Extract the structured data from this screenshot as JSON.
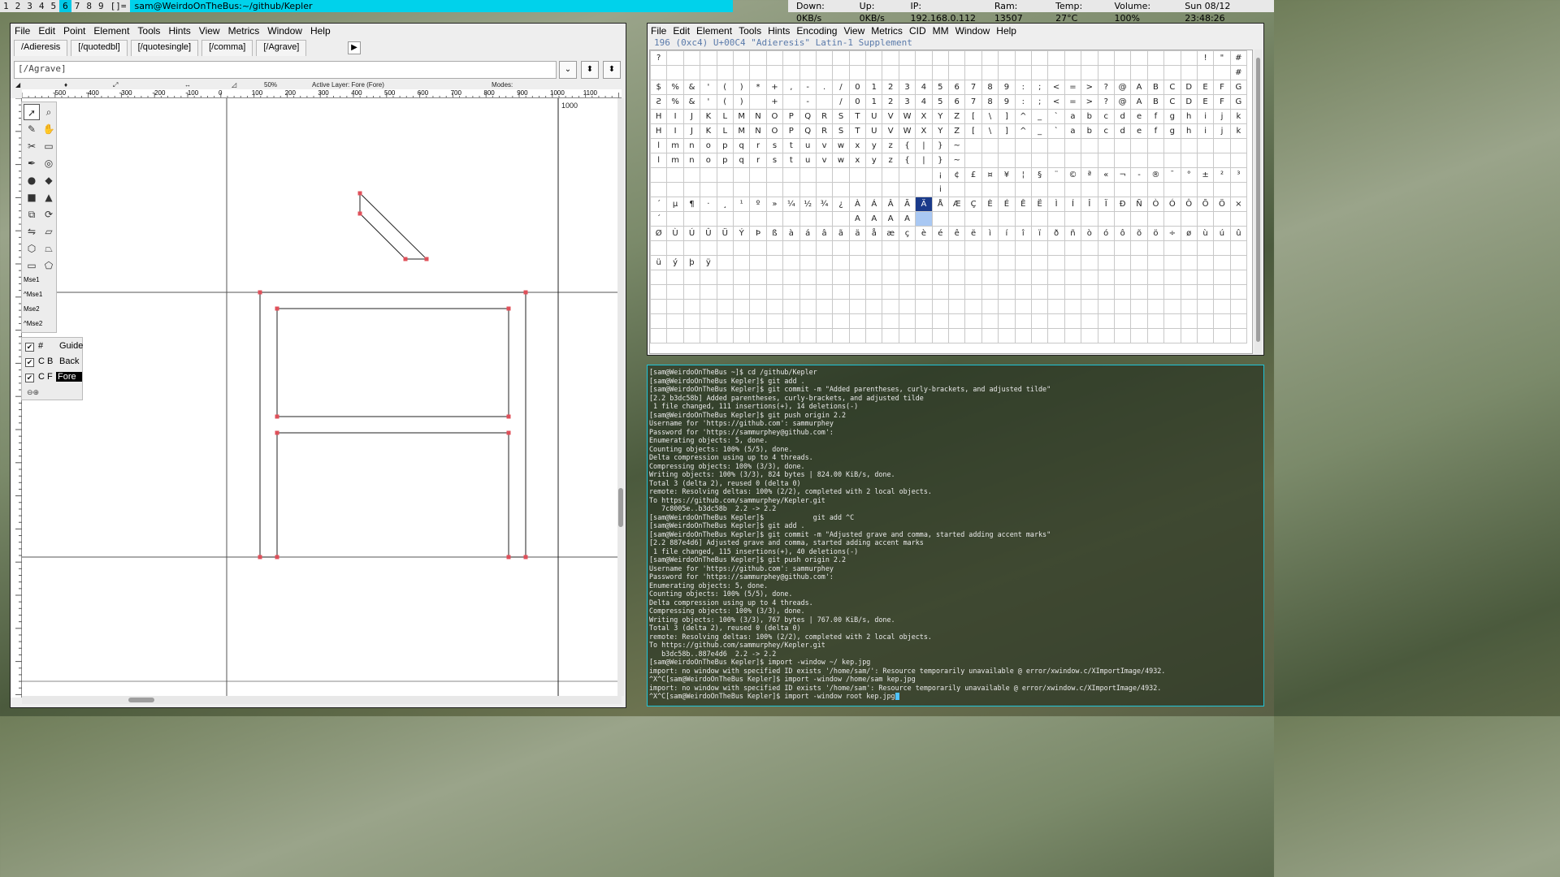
{
  "topbar": {
    "workspaces": [
      {
        "label": "1",
        "active": false
      },
      {
        "label": "2",
        "active": false
      },
      {
        "label": "3",
        "active": false
      },
      {
        "label": "4",
        "active": false
      },
      {
        "label": "5",
        "active": false
      },
      {
        "label": "6",
        "active": true
      },
      {
        "label": "7",
        "active": false
      },
      {
        "label": "8",
        "active": false
      },
      {
        "label": "9",
        "active": false
      },
      {
        "label": "[]=",
        "active": false
      }
    ],
    "title": "sam@WeirdoOnTheBus:~/github/Kepler",
    "down": "Down: 0KB/s",
    "up": "Up: 0KB/s",
    "ip": "IP: 192.168.0.112",
    "ram": "Ram: 13507",
    "temp": "Temp: 27°C",
    "volume": "Volume: 100%",
    "clock": "Sun 08/12 23:48:26"
  },
  "glyph_window": {
    "menu": [
      "File",
      "Edit",
      "Point",
      "Element",
      "Tools",
      "Hints",
      "View",
      "Metrics",
      "Window",
      "Help"
    ],
    "tabs": [
      "/Adieresis",
      "[/quotedbl]",
      "[/quotesingle]",
      "[/comma]",
      "[/Agrave]"
    ],
    "glyph_field": "[/Agrave]",
    "info": {
      "zoom": "50%",
      "active_layer": "Active Layer: Fore (Fore)",
      "modes": "Modes:",
      "ruler_right": "1000"
    },
    "ruler_ticks": [
      "-500",
      "-400",
      "-300",
      "-200",
      "-100",
      "0",
      "100",
      "200",
      "300",
      "400",
      "500",
      "600",
      "700",
      "800",
      "900",
      "1000",
      "1100"
    ],
    "mouse_labels": [
      "Mse1",
      "^Mse1",
      "Mse2",
      "^Mse2"
    ],
    "layers": [
      {
        "tag": "#",
        "name": "Guide",
        "checked": true,
        "active": false
      },
      {
        "tag": "C B",
        "name": "Back",
        "checked": true,
        "active": false
      },
      {
        "tag": "C F",
        "name": "Fore",
        "checked": true,
        "active": true
      }
    ]
  },
  "font_window": {
    "menu": [
      "File",
      "Edit",
      "Element",
      "Tools",
      "Hints",
      "Encoding",
      "View",
      "Metrics",
      "CID",
      "MM",
      "Window",
      "Help"
    ],
    "glyph_info": "196 (0xc4) U+00C4 \"Adieresis\" Latin-1 Supplement",
    "label_rows": [
      [
        "?",
        "",
        "",
        "",
        "",
        "",
        "",
        "",
        "",
        "",
        "",
        "",
        "",
        "",
        "",
        "",
        "",
        "",
        "",
        "",
        "",
        "",
        "",
        "",
        "",
        "",
        "",
        "",
        "",
        "",
        "",
        "",
        "",
        "!",
        "\"",
        "#"
      ],
      [
        "$",
        "%",
        "&",
        "'",
        "(",
        ")",
        "*",
        "+",
        ",",
        "-",
        ".",
        "/",
        "0",
        "1",
        "2",
        "3",
        "4",
        "5",
        "6",
        "7",
        "8",
        "9",
        ":",
        ";",
        "<",
        "=",
        ">",
        "?",
        "@",
        "A",
        "B",
        "C",
        "D",
        "E",
        "F",
        "G"
      ],
      [
        "H",
        "I",
        "J",
        "K",
        "L",
        "M",
        "N",
        "O",
        "P",
        "Q",
        "R",
        "S",
        "T",
        "U",
        "V",
        "W",
        "X",
        "Y",
        "Z",
        "[",
        "\\",
        "]",
        "^",
        "_",
        "`",
        "a",
        "b",
        "c",
        "d",
        "e",
        "f",
        "g",
        "h",
        "i",
        "j",
        "k"
      ],
      [
        "l",
        "m",
        "n",
        "o",
        "p",
        "q",
        "r",
        "s",
        "t",
        "u",
        "v",
        "w",
        "x",
        "y",
        "z",
        "{",
        "|",
        "}",
        "~",
        "",
        "",
        "",
        "",
        "",
        "",
        "",
        "",
        "",
        "",
        "",
        "",
        "",
        "",
        "",
        "",
        ""
      ],
      [
        "",
        "",
        "",
        "",
        "",
        "",
        "",
        "",
        "",
        "",
        "",
        "",
        "",
        "",
        "",
        "",
        "",
        "¡",
        "¢",
        "£",
        "¤",
        "¥",
        "¦",
        "§",
        "¨",
        "©",
        "ª",
        "«",
        "¬",
        "-",
        "®",
        "¯",
        "°",
        "±",
        "²",
        "³"
      ],
      [
        "´",
        "µ",
        "¶",
        "·",
        "¸",
        "¹",
        "º",
        "»",
        "¼",
        "½",
        "¾",
        "¿",
        "À",
        "Á",
        "Â",
        "Ã",
        "Ä",
        "Å",
        "Æ",
        "Ç",
        "È",
        "É",
        "Ê",
        "Ë",
        "Ì",
        "Í",
        "Î",
        "Ï",
        "Ð",
        "Ñ",
        "Ò",
        "Ó",
        "Ô",
        "Õ",
        "Ö",
        "×"
      ],
      [
        "Ø",
        "Ù",
        "Ú",
        "Û",
        "Ü",
        "Ý",
        "Þ",
        "ß",
        "à",
        "á",
        "â",
        "ã",
        "ä",
        "å",
        "æ",
        "ç",
        "è",
        "é",
        "ê",
        "ë",
        "ì",
        "í",
        "î",
        "ï",
        "ð",
        "ñ",
        "ò",
        "ó",
        "ô",
        "õ",
        "ö",
        "÷",
        "ø",
        "ù",
        "ú",
        "û"
      ],
      [
        "ü",
        "ý",
        "þ",
        "ÿ",
        "",
        "",
        "",
        "",
        "",
        "",
        "",
        "",
        "",
        "",
        "",
        "",
        "",
        "",
        "",
        "",
        "",
        "",
        "",
        "",
        "",
        "",
        "",
        "",
        "",
        "",
        "",
        "",
        "",
        "",
        "",
        ""
      ],
      [
        "",
        "",
        "",
        "",
        "",
        "",
        "",
        "",
        "",
        "",
        "",
        "",
        "",
        "",
        "",
        "",
        "",
        "",
        "",
        "",
        "",
        "",
        "",
        "",
        "",
        "",
        "",
        "",
        "",
        "",
        "",
        "",
        "",
        "",
        "",
        ""
      ],
      [
        "",
        "",
        "",
        "",
        "",
        "",
        "",
        "",
        "",
        "",
        "",
        "",
        "",
        "",
        "",
        "",
        "",
        "",
        "",
        "",
        "",
        "",
        "",
        "",
        "",
        "",
        "",
        "",
        "",
        "",
        "",
        "",
        "",
        "",
        "",
        ""
      ]
    ],
    "glyph_rows": [
      [
        "",
        "",
        "",
        "",
        "",
        "",
        "",
        "",
        "",
        "",
        "",
        "",
        "",
        "",
        "",
        "",
        "",
        "",
        "",
        "",
        "",
        "",
        "",
        "",
        "",
        "",
        "",
        "",
        "",
        "",
        "",
        "",
        "",
        "",
        "",
        "#"
      ],
      [
        "Ƨ",
        "%",
        "&",
        "'",
        "(",
        ")",
        "",
        "+",
        "",
        "-",
        "",
        "/",
        "0",
        "1",
        "2",
        "3",
        "4",
        "5",
        "6",
        "7",
        "8",
        "9",
        ":",
        ";",
        "<",
        "=",
        ">",
        "?",
        "@",
        "A",
        "B",
        "C",
        "D",
        "E",
        "F",
        "G"
      ],
      [
        "H",
        "I",
        "J",
        "K",
        "L",
        "M",
        "N",
        "O",
        "P",
        "Q",
        "R",
        "S",
        "T",
        "U",
        "V",
        "W",
        "X",
        "Y",
        "Z",
        "[",
        "\\",
        "]",
        "^",
        "_",
        "`",
        "a",
        "b",
        "c",
        "d",
        "e",
        "f",
        "g",
        "h",
        "i",
        "j",
        "k"
      ],
      [
        "l",
        "m",
        "n",
        "o",
        "p",
        "q",
        "r",
        "s",
        "t",
        "u",
        "v",
        "w",
        "x",
        "y",
        "z",
        "{",
        "|",
        "}",
        "~",
        "",
        "",
        "",
        "",
        "",
        "",
        "",
        "",
        "",
        "",
        "",
        "",
        "",
        "",
        "",
        "",
        ""
      ],
      [
        "",
        "",
        "",
        "",
        "",
        "",
        "",
        "",
        "",
        "",
        "",
        "",
        "",
        "",
        "",
        "",
        "",
        "i",
        "",
        "",
        "",
        "",
        "",
        "",
        "",
        "",
        "",
        "",
        "",
        "",
        "",
        "",
        "",
        "",
        "",
        ""
      ],
      [
        "´",
        "",
        "",
        "",
        "",
        "",
        "",
        "",
        "",
        "",
        "",
        "",
        "A",
        "A",
        "A",
        "A",
        "",
        "",
        "",
        "",
        "",
        "",
        "",
        "",
        "",
        "",
        "",
        "",
        "",
        "",
        "",
        "",
        "",
        "",
        "",
        ""
      ],
      [
        "",
        "",
        "",
        "",
        "",
        "",
        "",
        "",
        "",
        "",
        "",
        "",
        "",
        "",
        "",
        "",
        "",
        "",
        "",
        "",
        "",
        "",
        "",
        "",
        "",
        "",
        "",
        "",
        "",
        "",
        "",
        "",
        "",
        "",
        "",
        ""
      ],
      [
        "",
        "",
        "",
        "",
        "",
        "",
        "",
        "",
        "",
        "",
        "",
        "",
        "",
        "",
        "",
        "",
        "",
        "",
        "",
        "",
        "",
        "",
        "",
        "",
        "",
        "",
        "",
        "",
        "",
        "",
        "",
        "",
        "",
        "",
        "",
        ""
      ],
      [
        "",
        "",
        "",
        "",
        "",
        "",
        "",
        "",
        "",
        "",
        "",
        "",
        "",
        "",
        "",
        "",
        "",
        "",
        "",
        "",
        "",
        "",
        "",
        "",
        "",
        "",
        "",
        "",
        "",
        "",
        "",
        "",
        "",
        "",
        "",
        ""
      ],
      [
        "",
        "",
        "",
        "",
        "",
        "",
        "",
        "",
        "",
        "",
        "",
        "",
        "",
        "",
        "",
        "",
        "",
        "",
        "",
        "",
        "",
        "",
        "",
        "",
        "",
        "",
        "",
        "",
        "",
        "",
        "",
        "",
        "",
        "",
        "",
        ""
      ]
    ]
  },
  "terminal": {
    "lines": [
      {
        "text": "[sam@WeirdoOnTheBus ~]$ cd /github/Kepler",
        "url": ""
      },
      {
        "text": "[sam@WeirdoOnTheBus Kepler]$ git add .",
        "url": ""
      },
      {
        "text": "[sam@WeirdoOnTheBus Kepler]$ git commit -m \"Added parentheses, curly-brackets, and adjusted tilde\"",
        "url": ""
      },
      {
        "text": "[2.2 b3dc58b] Added parentheses, curly-brackets, and adjusted tilde",
        "url": ""
      },
      {
        "text": " 1 file changed, 111 insertions(+), 14 deletions(-)",
        "url": ""
      },
      {
        "text": "[sam@WeirdoOnTheBus Kepler]$ git push origin 2.2",
        "url": ""
      },
      {
        "text": "Username for 'https://github.com': sammurphey",
        "url": ""
      },
      {
        "text": "Password for 'https://sammurphey@github.com':",
        "url": ""
      },
      {
        "text": "Enumerating objects: 5, done.",
        "url": ""
      },
      {
        "text": "Counting objects: 100% (5/5), done.",
        "url": ""
      },
      {
        "text": "Delta compression using up to 4 threads.",
        "url": ""
      },
      {
        "text": "Compressing objects: 100% (3/3), done.",
        "url": ""
      },
      {
        "text": "Writing objects: 100% (3/3), 824 bytes | 824.00 KiB/s, done.",
        "url": ""
      },
      {
        "text": "Total 3 (delta 2), reused 0 (delta 0)",
        "url": ""
      },
      {
        "text": "remote: Resolving deltas: 100% (2/2), completed with 2 local objects.",
        "url": ""
      },
      {
        "text": "To https://github.com/sammurphey/Kepler.git",
        "url": ""
      },
      {
        "text": "   7c8005e..b3dc58b  2.2 -> 2.2",
        "url": ""
      },
      {
        "text": "[sam@WeirdoOnTheBus Kepler]$            git add ^C",
        "url": ""
      },
      {
        "text": "[sam@WeirdoOnTheBus Kepler]$ git add .",
        "url": ""
      },
      {
        "text": "[sam@WeirdoOnTheBus Kepler]$ git commit -m \"Adjusted grave and comma, started adding accent marks\"",
        "url": ""
      },
      {
        "text": "[2.2 887e4d6] Adjusted grave and comma, started adding accent marks",
        "url": ""
      },
      {
        "text": " 1 file changed, 115 insertions(+), 40 deletions(-)",
        "url": ""
      },
      {
        "text": "[sam@WeirdoOnTheBus Kepler]$ git push origin 2.2",
        "url": ""
      },
      {
        "text": "Username for 'https://github.com': sammurphey",
        "url": ""
      },
      {
        "text": "Password for 'https://sammurphey@github.com':",
        "url": ""
      },
      {
        "text": "Enumerating objects: 5, done.",
        "url": ""
      },
      {
        "text": "Counting objects: 100% (5/5), done.",
        "url": ""
      },
      {
        "text": "Delta compression using up to 4 threads.",
        "url": ""
      },
      {
        "text": "Compressing objects: 100% (3/3), done.",
        "url": ""
      },
      {
        "text": "Writing objects: 100% (3/3), 767 bytes | 767.00 KiB/s, done.",
        "url": ""
      },
      {
        "text": "Total 3 (delta 2), reused 0 (delta 0)",
        "url": ""
      },
      {
        "text": "remote: Resolving deltas: 100% (2/2), completed with 2 local objects.",
        "url": ""
      },
      {
        "text": "To https://github.com/sammurphey/Kepler.git",
        "url": ""
      },
      {
        "text": "   b3dc58b..887e4d6  2.2 -> 2.2",
        "url": ""
      },
      {
        "text": "[sam@WeirdoOnTheBus Kepler]$ import -window ~/ kep.jpg",
        "url": ""
      },
      {
        "text": "import: no window with specified ID exists '/home/sam/': Resource temporarily unavailable @ error/xwindow.c/XImportImage/4932.",
        "url": ""
      },
      {
        "text": "^X^C[sam@WeirdoOnTheBus Kepler]$ import -window /home/sam kep.jpg",
        "url": ""
      },
      {
        "text": "import: no window with specified ID exists '/home/sam': Resource temporarily unavailable @ error/xwindow.c/XImportImage/4932.",
        "url": ""
      },
      {
        "text": "^X^C[sam@WeirdoOnTheBus Kepler]$ import -window root kep.jpg",
        "url": ""
      }
    ]
  },
  "colors": {
    "workspace_active": "#00c8e6",
    "title_bar": "#00d2eb",
    "terminal_border": "#1fc4d8",
    "selected_glyph": "#1a3a8a",
    "point_marker": "#e0505a"
  }
}
